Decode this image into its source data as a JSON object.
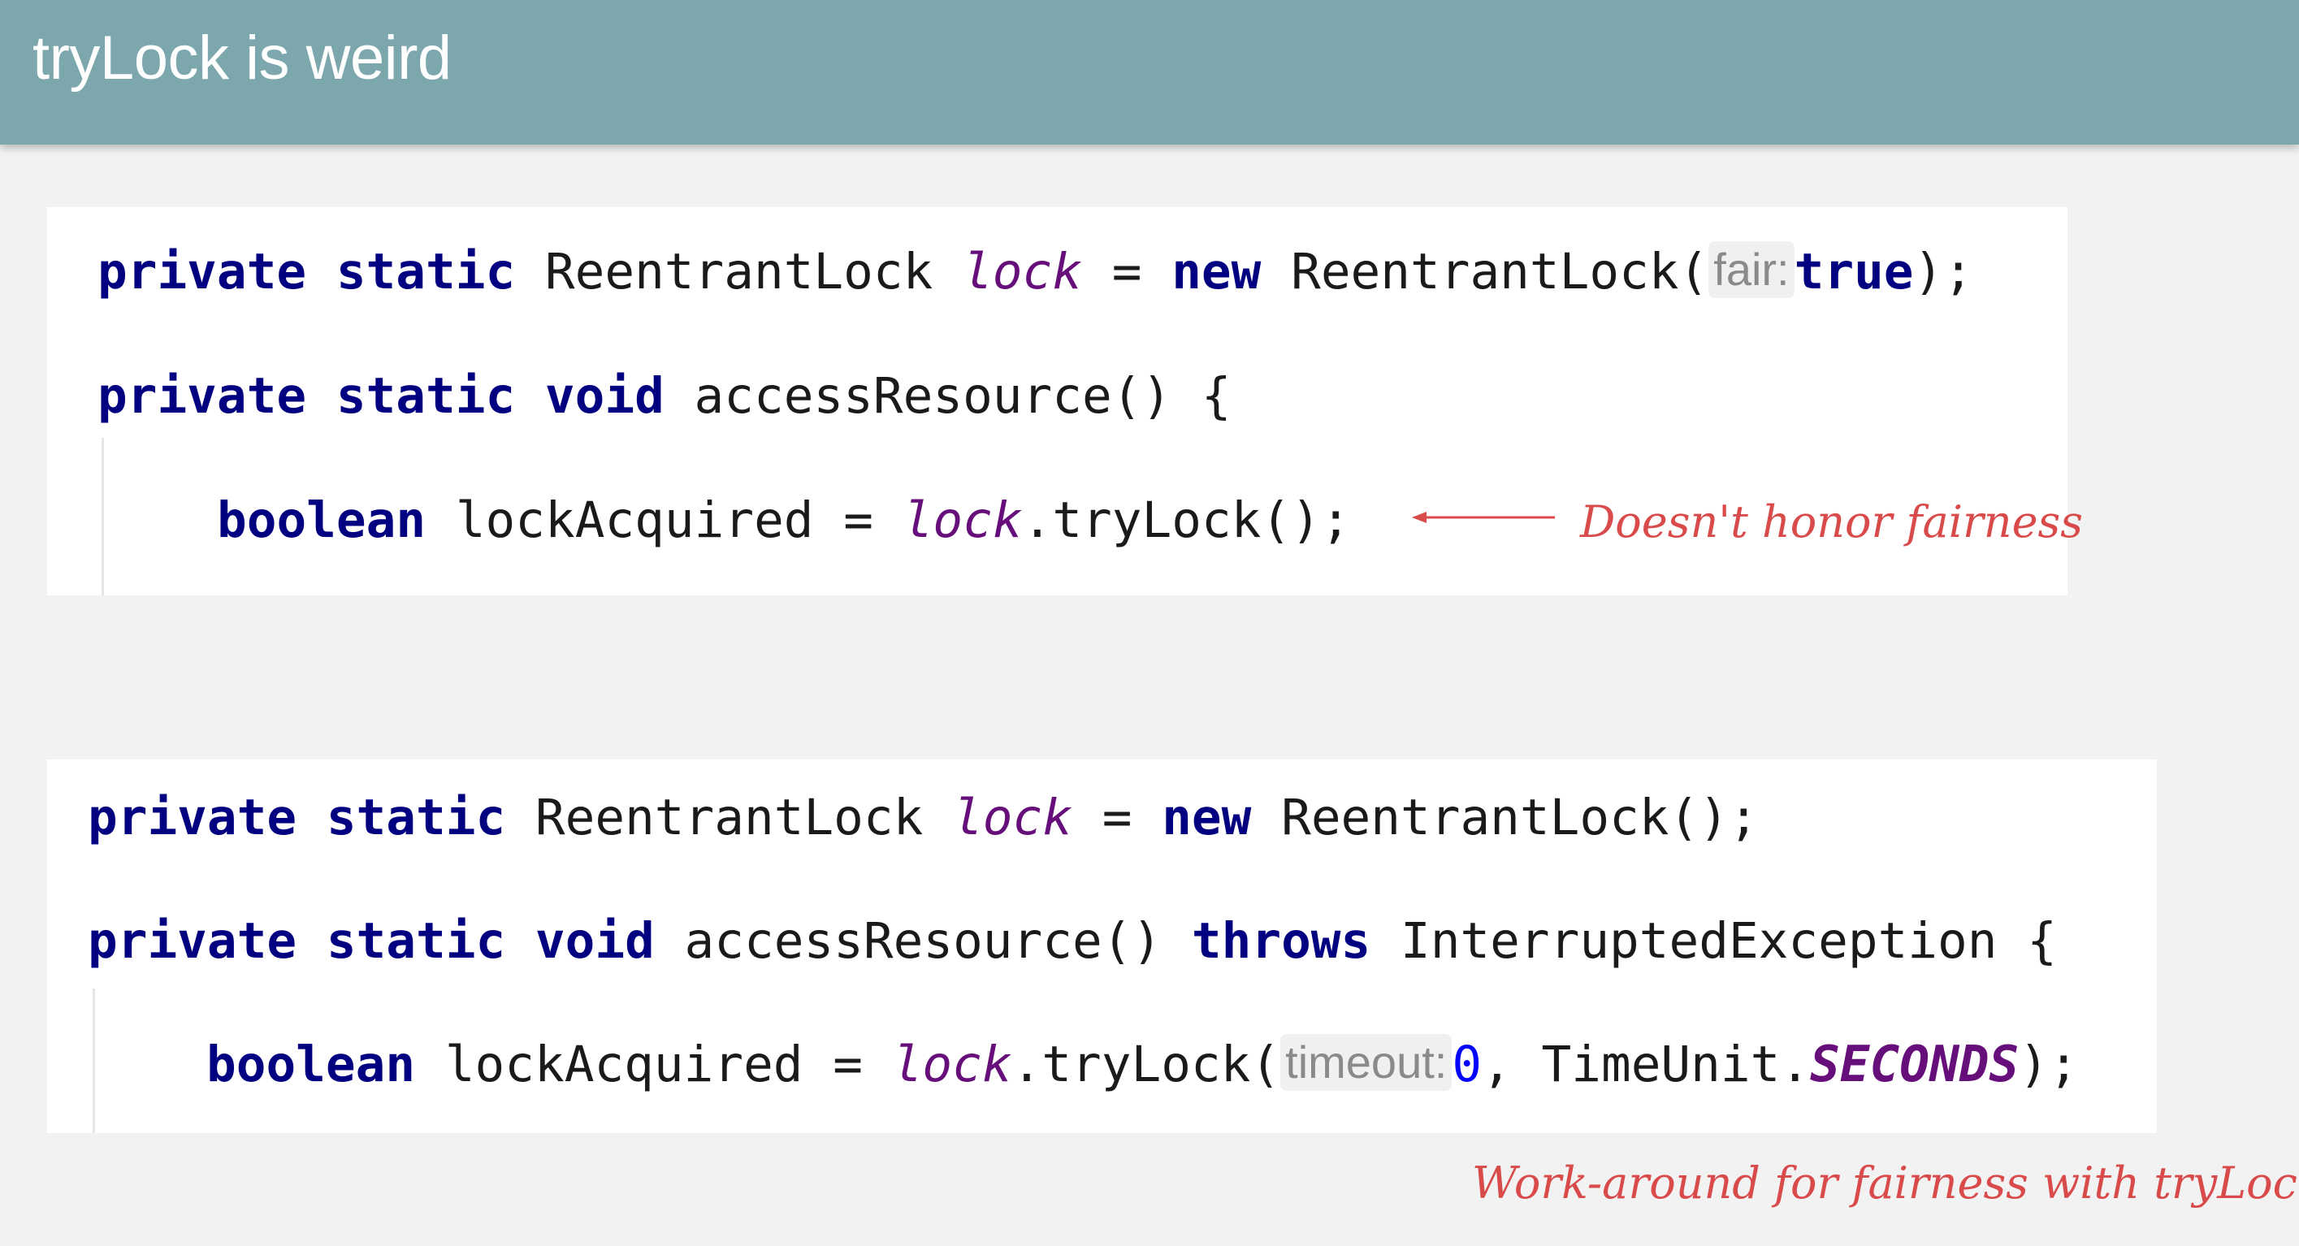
{
  "slide": {
    "title": "tryLock is weird"
  },
  "block1": {
    "line1": {
      "private": "private",
      "static": "static",
      "type": "ReentrantLock",
      "field": "lock",
      "eq": "=",
      "new": "new",
      "ctor": "ReentrantLock(",
      "hint": "fair:",
      "value": "true",
      "end": ");"
    },
    "line2": {
      "private": "private",
      "static": "static",
      "void": "void",
      "method": "accessResource() {"
    },
    "line3": {
      "type": "boolean",
      "var": "lockAcquired =",
      "field": "lock",
      "call": ".tryLock();"
    },
    "annotation": "Doesn't honor fairness"
  },
  "block2": {
    "line1": {
      "private": "private",
      "static": "static",
      "type": "ReentrantLock",
      "field": "lock",
      "eq": "=",
      "new": "new",
      "ctor": "ReentrantLock();"
    },
    "line2": {
      "private": "private",
      "static": "static",
      "void": "void",
      "method": "accessResource()",
      "throws": "throws",
      "exception": "InterruptedException {"
    },
    "line3": {
      "type": "boolean",
      "var": "lockAcquired =",
      "field": "lock",
      "call": ".tryLock(",
      "hint": "timeout:",
      "value": "0",
      "mid": ", TimeUnit.",
      "const": "SECONDS",
      "end": ");"
    }
  },
  "caption": "Work-around for fairness with tryLock",
  "colors": {
    "header": "#7ba7ad",
    "keyword": "#000080",
    "field": "#660e7a",
    "number": "#0000ff",
    "annotation": "#d94a4a"
  }
}
